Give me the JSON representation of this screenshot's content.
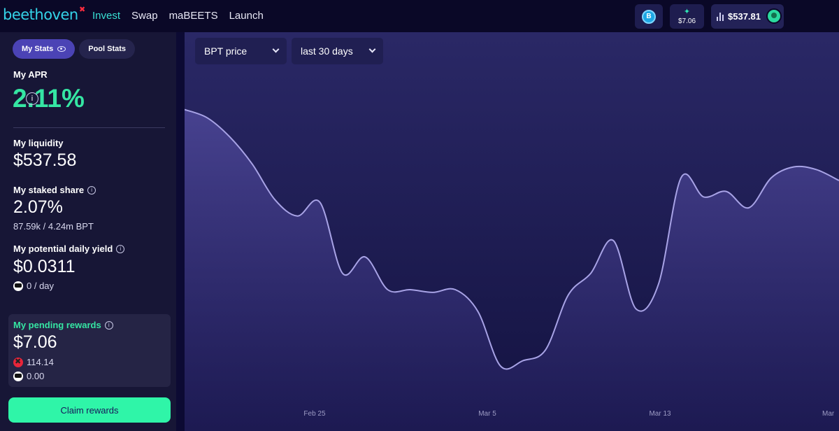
{
  "nav": {
    "logo_text": "beethoven",
    "logo_mark": "✖",
    "items": [
      {
        "label": "Invest",
        "active": true
      },
      {
        "label": "Swap",
        "active": false
      },
      {
        "label": "maBEETS",
        "active": false
      },
      {
        "label": "Launch",
        "active": false
      }
    ]
  },
  "header_right": {
    "pending_rewards": "$7.06",
    "liquidity": "$537.81",
    "coin_letter": "B"
  },
  "stats": {
    "tab_my": "My Stats",
    "tab_pool": "Pool Stats",
    "apr_label": "My APR",
    "apr_value": "2.11%",
    "liquidity_label": "My liquidity",
    "liquidity_value": "$537.58",
    "staked_label": "My staked share",
    "staked_value": "2.07%",
    "staked_sub": "87.59k / 4.24m BPT",
    "yield_label": "My potential daily yield",
    "yield_value": "$0.0311",
    "yield_sub": "0 / day",
    "pending_label": "My pending rewards",
    "pending_value": "$7.06",
    "pending_token1": "114.14",
    "pending_token2": "0.00",
    "claim_label": "Claim rewards"
  },
  "chart_controls": {
    "metric": "BPT price",
    "range": "last 30 days"
  },
  "colors": {
    "accent_green": "#35e6a3",
    "accent_teal": "#38e0d3",
    "line": "#a8a3e6",
    "claim_button": "#2ff5a8"
  },
  "chart_data": {
    "type": "area",
    "title": "",
    "xlabel": "",
    "ylabel": "",
    "x_ticks": [
      "Feb 25",
      "Mar 5",
      "Mar 13",
      "Mar"
    ],
    "x": [
      0,
      1,
      2,
      3,
      4,
      5,
      6,
      7,
      8,
      9,
      10,
      11,
      12,
      13,
      14,
      15,
      16,
      17,
      18,
      19,
      20,
      21,
      22,
      23,
      24,
      25,
      26,
      27,
      28,
      29
    ],
    "values": [
      0.96,
      0.93,
      0.86,
      0.76,
      0.63,
      0.57,
      0.62,
      0.36,
      0.42,
      0.3,
      0.3,
      0.29,
      0.3,
      0.22,
      0.02,
      0.04,
      0.08,
      0.28,
      0.36,
      0.48,
      0.23,
      0.32,
      0.71,
      0.64,
      0.66,
      0.6,
      0.71,
      0.75,
      0.74,
      0.7
    ],
    "ylim": [
      0,
      1
    ]
  }
}
